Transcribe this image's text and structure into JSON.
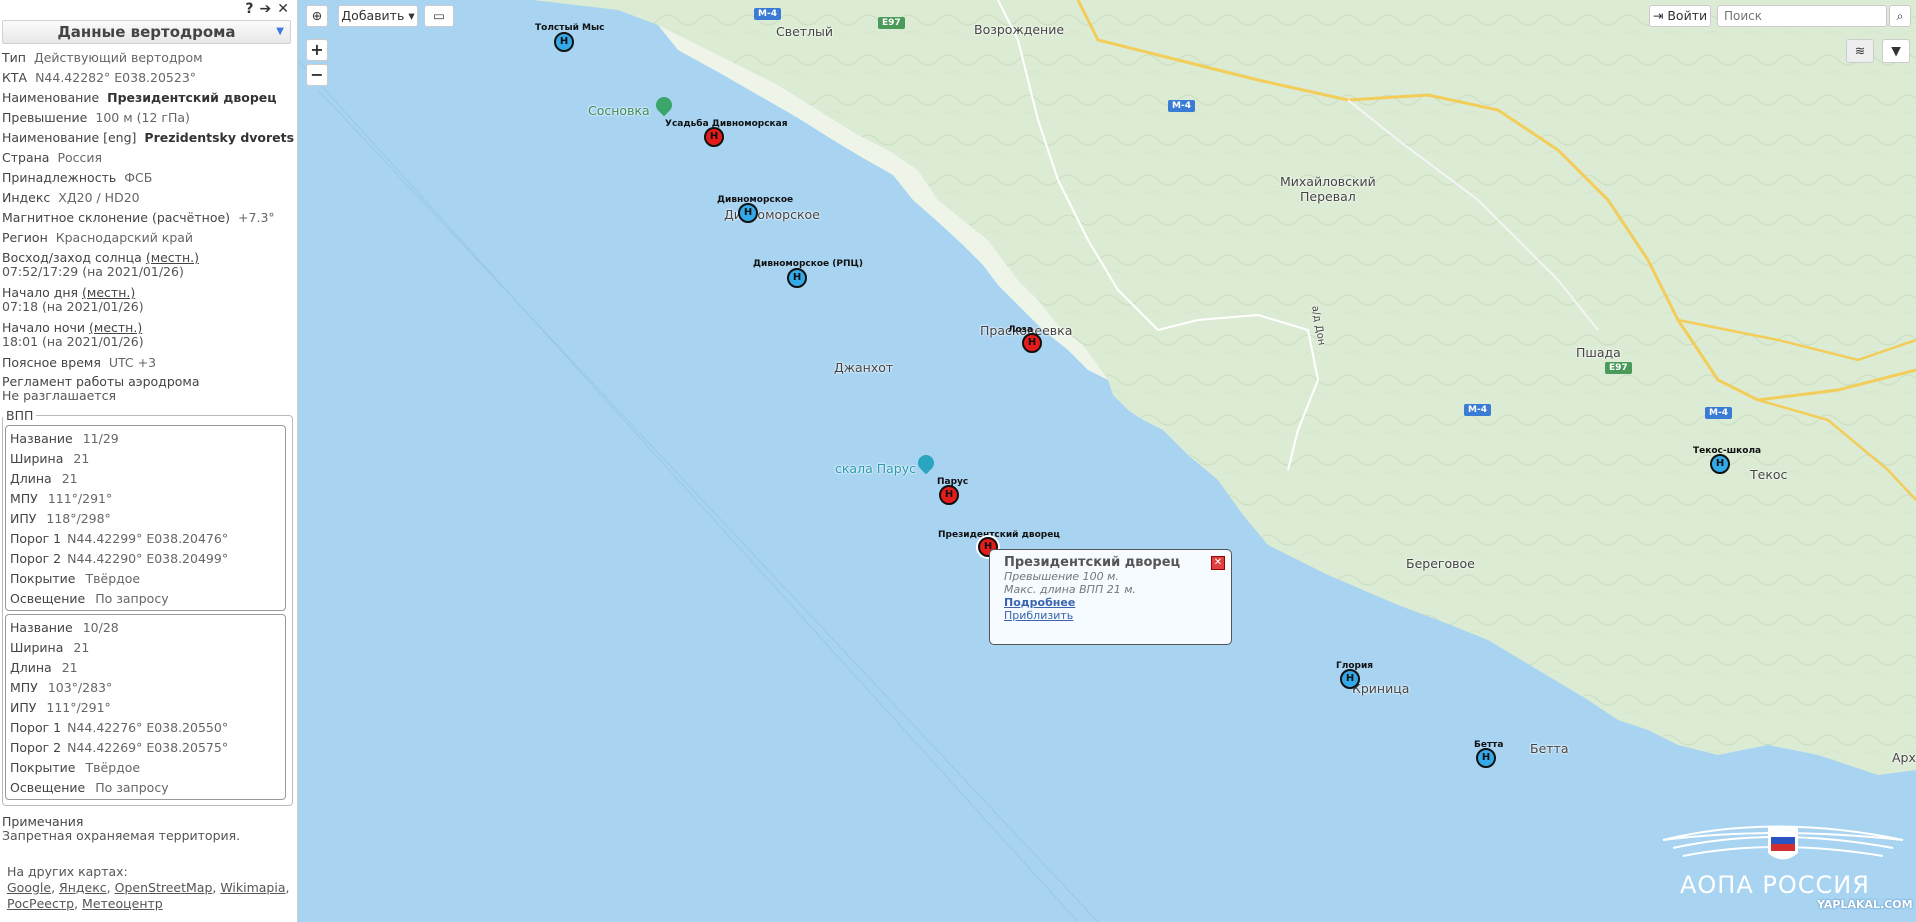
{
  "sidebar": {
    "title": "Данные вертодрома",
    "icons": {
      "help": "?",
      "forward": "➔",
      "close": "✕",
      "caret": "▼"
    },
    "fields": {
      "type_k": "Тип",
      "type_v": "Действующий вертодром",
      "kta_k": "КТА",
      "kta_v": "N44.42282° E038.20523°",
      "name_k": "Наименование",
      "name_v": "Президентский дворец",
      "elev_k": "Превышение",
      "elev_v": "100 м (12 гПа)",
      "name_en_k": "Наименование [eng]",
      "name_en_v": "Prezidentsky dvorets",
      "country_k": "Страна",
      "country_v": "Россия",
      "owner_k": "Принадлежность",
      "owner_v": "ФСБ",
      "index_k": "Индекс",
      "index_v": "ХД20 / HD20",
      "magvar_k": "Магнитное склонение (расчётное)",
      "magvar_v": "+7.3°",
      "region_k": "Регион",
      "region_v": "Краснодарский край",
      "sun_k": "Восход/заход солнца",
      "sun_link": "(местн.)",
      "sun_v": "07:52/17:29 (на 2021/01/26)",
      "day_k": "Начало дня",
      "day_link": "(местн.)",
      "day_v": "07:18 (на 2021/01/26)",
      "night_k": "Начало ночи",
      "night_link": "(местн.)",
      "night_v": "18:01 (на 2021/01/26)",
      "tz_k": "Поясное время",
      "tz_v": "UTC +3",
      "reg_k": "Регламент работы аэродрома",
      "reg_v": "Не разглашается"
    },
    "vpp_legend": "ВПП",
    "runways": [
      {
        "name_k": "Название",
        "name": "11/29",
        "w_k": "Ширина",
        "w": "21",
        "l_k": "Длина",
        "l": "21",
        "mpu_k": "МПУ",
        "mpu": "111°/291°",
        "ipu_k": "ИПУ",
        "ipu": "118°/298°",
        "p1_k": "Порог 1",
        "p1": "N44.42299° E038.20476°",
        "p2_k": "Порог 2",
        "p2": "N44.42290° E038.20499°",
        "cov_k": "Покрытие",
        "cov": "Твёрдое",
        "light_k": "Освещение",
        "light": "По запросу"
      },
      {
        "name_k": "Название",
        "name": "10/28",
        "w_k": "Ширина",
        "w": "21",
        "l_k": "Длина",
        "l": "21",
        "mpu_k": "МПУ",
        "mpu": "103°/283°",
        "ipu_k": "ИПУ",
        "ipu": "111°/291°",
        "p1_k": "Порог 1",
        "p1": "N44.42276° E038.20550°",
        "p2_k": "Порог 2",
        "p2": "N44.42269° E038.20575°",
        "cov_k": "Покрытие",
        "cov": "Твёрдое",
        "light_k": "Освещение",
        "light": "По запросу"
      }
    ],
    "notes_k": "Примечания",
    "notes_v": "Запретная охраняемая территория.",
    "other_maps_label": "На других картах:",
    "other_maps": [
      "Google",
      "Яндекс",
      "OpenStreetMap",
      "Wikimapia",
      "РосРеестр",
      "Метеоцентр"
    ]
  },
  "toolbar": {
    "add_label": "Добавить",
    "login_label": "Войти",
    "search_placeholder": "Поиск",
    "zoom_in": "+",
    "zoom_out": "−"
  },
  "map": {
    "places": {
      "svetly": "Светлый",
      "vozrozhdenie": "Возрождение",
      "sosnovka": "Сосновка",
      "divnomorskoe": "Дивноморское",
      "mikh1": "Михайловский",
      "mikh2": "Перевал",
      "praskoveevka": "Прасковеевка",
      "dzhankhot": "Джанхот",
      "pshada": "Пшада",
      "skala_parus": "скала Парус",
      "tekos": "Текос",
      "beregovoe": "Береговое",
      "krinitsa": "Криница",
      "betta": "Бетта",
      "arkh": "Арх",
      "road": "а/д Дон"
    },
    "road_shields": [
      "М-4",
      "E97",
      "М-4",
      "E97",
      "М-4",
      "М-4"
    ],
    "heliports": [
      {
        "label": "Толстый Мыс",
        "kind": "blue",
        "letter": "H"
      },
      {
        "label": "Усадьба Дивноморская",
        "kind": "red",
        "letter": "H"
      },
      {
        "label": "Дивноморское",
        "kind": "blue",
        "letter": "H"
      },
      {
        "label": "Дивноморское (РПЦ)",
        "kind": "blue",
        "letter": "H"
      },
      {
        "label": "Лоза",
        "kind": "red",
        "letter": "H"
      },
      {
        "label": "Парус",
        "kind": "red",
        "letter": "H"
      },
      {
        "label": "Президентский дворец",
        "kind": "red",
        "letter": "H"
      },
      {
        "label": "Текос-школа",
        "kind": "blue",
        "letter": "H"
      },
      {
        "label": "Глория",
        "kind": "blue",
        "letter": "H"
      },
      {
        "label": "Бетта",
        "kind": "blue",
        "letter": "H"
      }
    ],
    "popup": {
      "title": "Президентский дворец",
      "elev": "Превышение 100 м.",
      "maxlen": "Макс. длина ВПП 21 м.",
      "more": "Подробнее",
      "zoom": "Приблизить"
    },
    "logo_text": "АОПА РОССИЯ",
    "watermark": "YAPLAKAL.COM"
  }
}
